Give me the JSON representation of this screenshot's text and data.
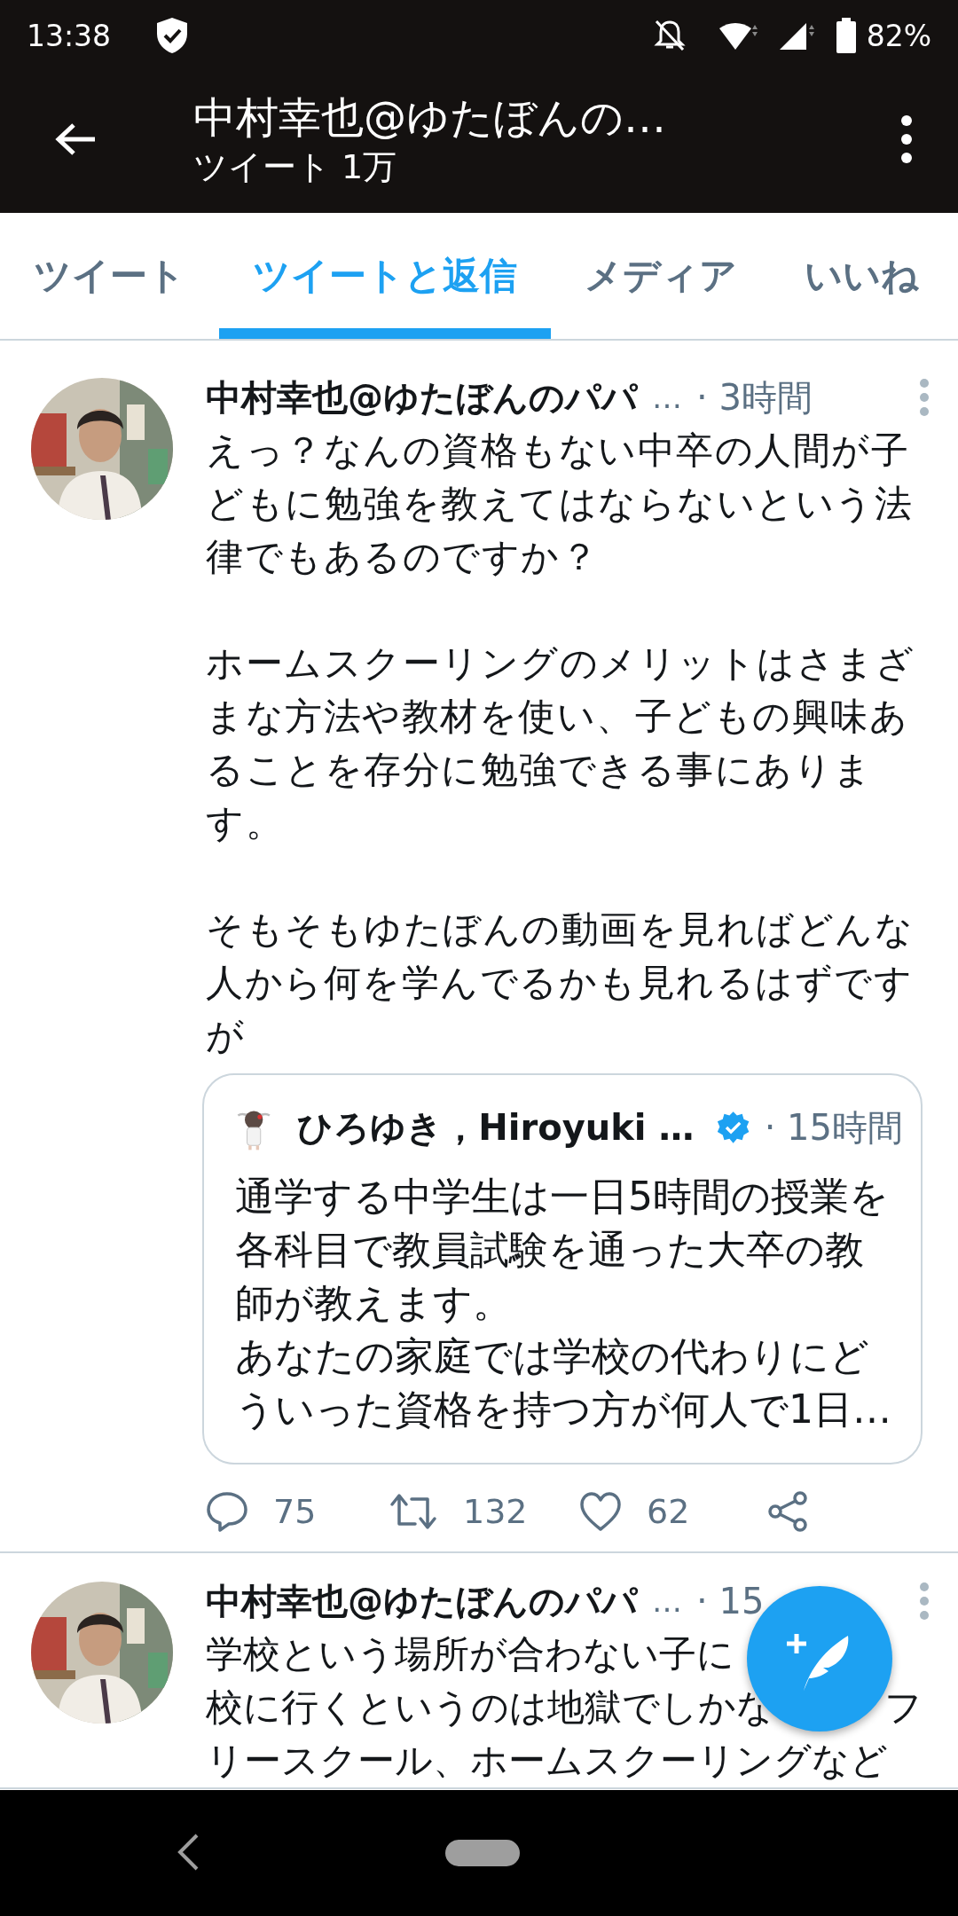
{
  "status_bar": {
    "time": "13:38",
    "battery": "82%"
  },
  "header": {
    "title": "中村幸也@ゆたぼんの…",
    "subtitle": "ツイート 1万"
  },
  "tabs": [
    {
      "label": "ツイート",
      "selected": false
    },
    {
      "label": "ツイートと返信",
      "selected": true
    },
    {
      "label": "メディア",
      "selected": false
    },
    {
      "label": "いいね",
      "selected": false
    }
  ],
  "tweets": [
    {
      "author": "中村幸也@ゆたぼんのパパ",
      "handle": "…",
      "time": "· 3時間",
      "paragraphs": [
        "えっ？なんの資格もない中卒の人間が子どもに勉強を教えてはならないという法律でもあるのですか？",
        "ホームスクーリングのメリットはさまざまな方法や教材を使い、子どもの興味あることを存分に勉強できる事にあります。",
        "そもそもゆたぼんの動画を見ればどんな人から何を学んでるかも見れるはずですが"
      ],
      "quote": {
        "author": "ひろゆき，Hiroyuki …",
        "verified": true,
        "time": "· 15時間",
        "paragraphs": [
          "通学する中学生は一日5時間の授業を各科目で教員試験を通った大卒の教師が教えます。",
          "あなたの家庭では学校の代わりにどういった資格を持つ方が何人で1日…"
        ]
      },
      "stats": {
        "replies": "75",
        "retweets": "132",
        "likes": "62"
      }
    },
    {
      "author": "中村幸也@ゆたぼんのパパ",
      "handle": "…",
      "time": "· 15",
      "lines": [
        {
          "text": "学校という場所が合わない子に"
        },
        {
          "text": "校に行くというのは地獄でしかな",
          "end": "フ"
        },
        {
          "text": "リースクール、ホームスクーリングなど"
        }
      ]
    }
  ]
}
